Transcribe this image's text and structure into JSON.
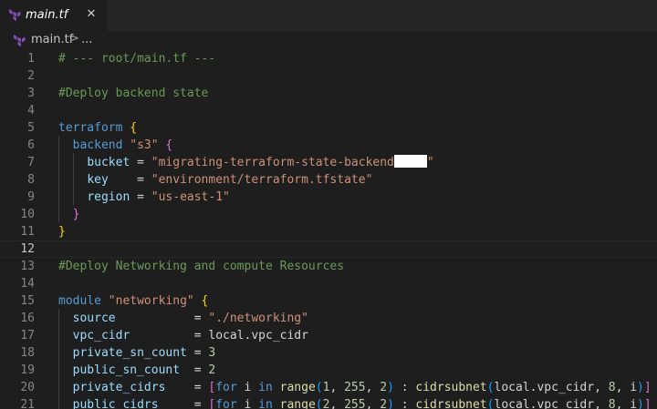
{
  "tab": {
    "label": "main.tf",
    "close": "✕",
    "icon": "terraform-icon"
  },
  "breadcrumb": {
    "file": "main.tf",
    "separator": ">",
    "more": "..."
  },
  "colors": {
    "comment": "#6a9955",
    "keyword": "#569cd6",
    "string": "#ce9178",
    "attribute": "#9cdcfe",
    "function": "#dcdcaa",
    "number": "#b5cea8",
    "bracket1": "#ffd700",
    "bracket2": "#da70d6",
    "bracket3": "#179fff",
    "text": "#d4d4d4",
    "terraform_purple": "#844fba"
  },
  "lines": [
    {
      "n": "1",
      "tokens": [
        [
          "comment",
          "# --- root/main.tf ---"
        ]
      ]
    },
    {
      "n": "2",
      "tokens": []
    },
    {
      "n": "3",
      "tokens": [
        [
          "comment",
          "#Deploy backend state"
        ]
      ]
    },
    {
      "n": "4",
      "tokens": []
    },
    {
      "n": "5",
      "tokens": [
        [
          "keyword",
          "terraform"
        ],
        [
          "text",
          " "
        ],
        [
          "bracket1",
          "{"
        ]
      ]
    },
    {
      "n": "6",
      "tokens": [
        [
          "text",
          "  "
        ],
        [
          "keyword",
          "backend"
        ],
        [
          "text",
          " "
        ],
        [
          "string",
          "\"s3\""
        ],
        [
          "text",
          " "
        ],
        [
          "bracket2",
          "{"
        ]
      ]
    },
    {
      "n": "7",
      "tokens": [
        [
          "text",
          "    "
        ],
        [
          "attribute",
          "bucket"
        ],
        [
          "text",
          " = "
        ],
        [
          "string",
          "\"migrating-terraform-state-backend"
        ],
        [
          "redact",
          ""
        ],
        [
          "string",
          "\""
        ]
      ]
    },
    {
      "n": "8",
      "tokens": [
        [
          "text",
          "    "
        ],
        [
          "attribute",
          "key"
        ],
        [
          "text",
          "    = "
        ],
        [
          "string",
          "\"environment/terraform.tfstate\""
        ]
      ]
    },
    {
      "n": "9",
      "tokens": [
        [
          "text",
          "    "
        ],
        [
          "attribute",
          "region"
        ],
        [
          "text",
          " = "
        ],
        [
          "string",
          "\"us-east-1\""
        ]
      ]
    },
    {
      "n": "10",
      "tokens": [
        [
          "text",
          "  "
        ],
        [
          "bracket2",
          "}"
        ]
      ]
    },
    {
      "n": "11",
      "tokens": [
        [
          "bracket1",
          "}"
        ]
      ]
    },
    {
      "n": "12",
      "tokens": [],
      "current": true
    },
    {
      "n": "13",
      "tokens": [
        [
          "comment",
          "#Deploy Networking and compute Resources"
        ]
      ]
    },
    {
      "n": "14",
      "tokens": []
    },
    {
      "n": "15",
      "tokens": [
        [
          "keyword",
          "module"
        ],
        [
          "text",
          " "
        ],
        [
          "string",
          "\"networking\""
        ],
        [
          "text",
          " "
        ],
        [
          "bracket1",
          "{"
        ]
      ]
    },
    {
      "n": "16",
      "tokens": [
        [
          "text",
          "  "
        ],
        [
          "attribute",
          "source"
        ],
        [
          "text",
          "           = "
        ],
        [
          "string",
          "\"./networking\""
        ]
      ]
    },
    {
      "n": "17",
      "tokens": [
        [
          "text",
          "  "
        ],
        [
          "attribute",
          "vpc_cidr"
        ],
        [
          "text",
          "         = "
        ],
        [
          "text",
          "local.vpc_cidr"
        ]
      ]
    },
    {
      "n": "18",
      "tokens": [
        [
          "text",
          "  "
        ],
        [
          "attribute",
          "private_sn_count"
        ],
        [
          "text",
          " = "
        ],
        [
          "number",
          "3"
        ]
      ]
    },
    {
      "n": "19",
      "tokens": [
        [
          "text",
          "  "
        ],
        [
          "attribute",
          "public_sn_count"
        ],
        [
          "text",
          "  = "
        ],
        [
          "number",
          "2"
        ]
      ]
    },
    {
      "n": "20",
      "tokens": [
        [
          "text",
          "  "
        ],
        [
          "attribute",
          "private_cidrs"
        ],
        [
          "text",
          "    = "
        ],
        [
          "bracket2",
          "["
        ],
        [
          "keyword",
          "for"
        ],
        [
          "text",
          " i "
        ],
        [
          "keyword",
          "in"
        ],
        [
          "text",
          " "
        ],
        [
          "function",
          "range"
        ],
        [
          "bracket3",
          "("
        ],
        [
          "number",
          "1"
        ],
        [
          "text",
          ", "
        ],
        [
          "number",
          "255"
        ],
        [
          "text",
          ", "
        ],
        [
          "number",
          "2"
        ],
        [
          "bracket3",
          ")"
        ],
        [
          "text",
          " : "
        ],
        [
          "function",
          "cidrsubnet"
        ],
        [
          "bracket3",
          "("
        ],
        [
          "text",
          "local.vpc_cidr, "
        ],
        [
          "number",
          "8"
        ],
        [
          "text",
          ", i"
        ],
        [
          "bracket3",
          ")"
        ],
        [
          "bracket2",
          "]"
        ]
      ]
    },
    {
      "n": "21",
      "tokens": [
        [
          "text",
          "  "
        ],
        [
          "attribute",
          "public_cidrs"
        ],
        [
          "text",
          "     = "
        ],
        [
          "bracket2",
          "["
        ],
        [
          "keyword",
          "for"
        ],
        [
          "text",
          " i "
        ],
        [
          "keyword",
          "in"
        ],
        [
          "text",
          " "
        ],
        [
          "function",
          "range"
        ],
        [
          "bracket3",
          "("
        ],
        [
          "number",
          "2"
        ],
        [
          "text",
          ", "
        ],
        [
          "number",
          "255"
        ],
        [
          "text",
          ", "
        ],
        [
          "number",
          "2"
        ],
        [
          "bracket3",
          ")"
        ],
        [
          "text",
          " : "
        ],
        [
          "function",
          "cidrsubnet"
        ],
        [
          "bracket3",
          "("
        ],
        [
          "text",
          "local.vpc_cidr, "
        ],
        [
          "number",
          "8"
        ],
        [
          "text",
          ", i"
        ],
        [
          "bracket3",
          ")"
        ],
        [
          "bracket2",
          "]"
        ]
      ]
    }
  ]
}
